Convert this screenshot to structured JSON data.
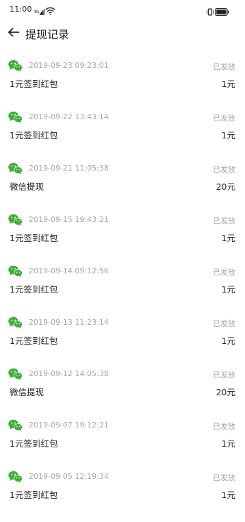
{
  "status_bar": {
    "time": "11:00",
    "icons": [
      "signal-icon",
      "wifi-icon",
      "vibrate-icon",
      "battery-icon"
    ]
  },
  "header": {
    "back_icon": "arrow-left-icon",
    "title": "提现记录"
  },
  "colors": {
    "wechat_green": "#3cb034",
    "secondary_text": "#a6a6a6",
    "primary_text": "#222222"
  },
  "records": [
    {
      "icon": "wechat-icon",
      "time": "2019-09-23 09:23:01",
      "status": "已发放",
      "desc": "1元签到红包",
      "amount": "1元"
    },
    {
      "icon": "wechat-icon",
      "time": "2019-09-22 13:43:14",
      "status": "已发放",
      "desc": "1元签到红包",
      "amount": "1元"
    },
    {
      "icon": "wechat-icon",
      "time": "2019-09-21 11:05:38",
      "status": "已发放",
      "desc": "微信提现",
      "amount": "20元"
    },
    {
      "icon": "wechat-icon",
      "time": "2019-09-15 19:43:21",
      "status": "已发放",
      "desc": "1元签到红包",
      "amount": "1元"
    },
    {
      "icon": "wechat-icon",
      "time": "2019-09-14 09:12:56",
      "status": "已发放",
      "desc": "1元签到红包",
      "amount": "1元"
    },
    {
      "icon": "wechat-icon",
      "time": "2019-09-13 11:23:14",
      "status": "已发放",
      "desc": "1元签到红包",
      "amount": "1元"
    },
    {
      "icon": "wechat-icon",
      "time": "2019-09-12 14:05:38",
      "status": "已发放",
      "desc": "微信提现",
      "amount": "20元"
    },
    {
      "icon": "wechat-icon",
      "time": "2019-09-07 19:12:21",
      "status": "已发放",
      "desc": "1元签到红包",
      "amount": "1元"
    },
    {
      "icon": "wechat-icon",
      "time": "2019-09-05 12:19:34",
      "status": "已发放",
      "desc": "1元签到红包",
      "amount": "1元"
    }
  ]
}
